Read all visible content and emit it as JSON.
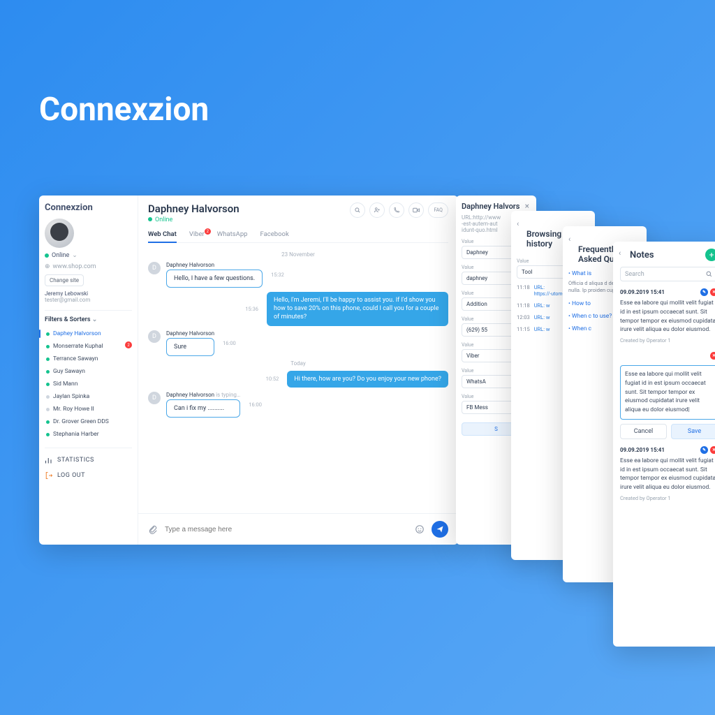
{
  "hero": {
    "title": "Connexzion"
  },
  "sidebar": {
    "brand": "Connexzion",
    "status": "Online",
    "site": "www.shop.com",
    "change_site": "Change site",
    "user_name": "Jeremy Lebowski",
    "user_email": "tester@gmail.com",
    "filters_label": "Filters & Sorters",
    "contacts": [
      {
        "name": "Daphey Halvorson",
        "online": true,
        "active": true
      },
      {
        "name": "Monserrate Kuphal",
        "online": true,
        "badge": "2"
      },
      {
        "name": "Terrance Sawayn",
        "online": true
      },
      {
        "name": "Guy Sawayn",
        "online": true
      },
      {
        "name": "Sid Mann",
        "online": true
      },
      {
        "name": "Jaylan Spinka",
        "online": false
      },
      {
        "name": "Mr. Roy Howe II",
        "online": false
      },
      {
        "name": "Dr. Grover Green DDS",
        "online": true
      },
      {
        "name": "Stephania Harber",
        "online": true
      }
    ],
    "nav_stats": "STATISTICS",
    "nav_logout": "LOG OUT"
  },
  "chat": {
    "title": "Daphney Halvorson",
    "status": "Online",
    "actions": {
      "faq": "FAQ"
    },
    "tabs": [
      {
        "label": "Web Chat",
        "active": true
      },
      {
        "label": "Viber",
        "badge": "2"
      },
      {
        "label": "WhatsApp"
      },
      {
        "label": "Facebook"
      }
    ],
    "day1": "23 November",
    "day2": "Today",
    "msgs": {
      "m1_sender": "Daphney Halvorson",
      "m1_text": "Hello, I have a few questions.",
      "m1_time": "15:32",
      "m2_text": "Hello, I'm Jeremi, I'll be happy to assist you. If I'd show you how to save 20% on this phone, could I call you for a couple of minutes?",
      "m2_time": "15:36",
      "m3_sender": "Daphney Halvorson",
      "m3_text": "Sure",
      "m3_time": "16:00",
      "m4_text": "Hi there, how are you? Do you enjoy your new phone?",
      "m4_time": "10:52",
      "m5_sender": "Daphney Halvorson",
      "m5_typing": "is typing…",
      "m5_text": "Can i fix my ..........",
      "m5_time": "16:00"
    },
    "composer_placeholder": "Type a message here"
  },
  "contact_panel": {
    "title": "Daphney Halvors",
    "url_label": "URL:http://www",
    "url_sub": "-est-autem-aut",
    "url_sub2": "idunt-quo.html",
    "label": "Value",
    "v1": "Daphney",
    "v2": "daphney",
    "v3": "Addition",
    "v4": "(629) 55",
    "v5": "Viber",
    "v6": "WhatsA",
    "v7": "FB Mess",
    "save": "S"
  },
  "history_panel": {
    "title": "Browsing history",
    "rows": [
      {
        "time": "11:18",
        "url": "URL:",
        "link": "https://-utom-an un.html"
      },
      {
        "time": "11:18",
        "url": "URL: w"
      },
      {
        "time": "12:03",
        "url": "URL: w"
      },
      {
        "time": "11:15",
        "url": "URL: w"
      }
    ],
    "label": "Value",
    "toolbox": "Tool"
  },
  "faq_panel": {
    "title": "Frequently Asked Quest",
    "q1": "What is",
    "a1": "Officia d aliqua d deserun nulla. Ip proiden cupidat",
    "q2": "How to",
    "q3": "When c to use?",
    "q4": "When c"
  },
  "notes_panel": {
    "title": "Notes",
    "search": "Search",
    "date1": "09.09.2019 15:41",
    "body1": "Esse ea labore qui mollit velit fugiat id in est ipsum occaecat sunt. Sit tempor tempor ex eiusmod cupidatat irure velit aliqua eu dolor eiusmod.",
    "by": "Created by Operator 1",
    "edit_text": "Esse ea labore qui mollit velit fugiat id in est ipsum occaecat sunt. Sit tempor tempor ex eiusmod cupidatat irure velit aliqua eu dolor eiusmod|",
    "cancel": "Cancel",
    "save": "Save",
    "date2": "09.09.2019 15:41",
    "body2": "Esse ea labore qui mollit velit fugiat id in est ipsum occaecat sunt. Sit tempor tempor ex eiusmod cupidatat irure velit aliqua eu dolor eiusmod."
  }
}
